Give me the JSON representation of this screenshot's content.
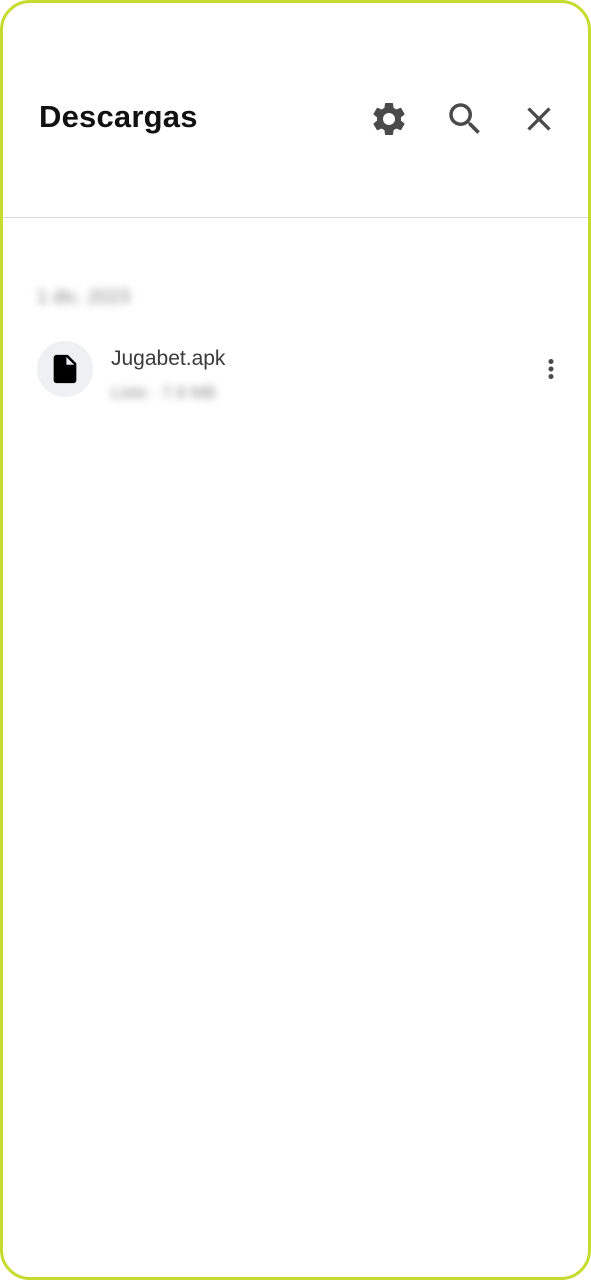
{
  "header": {
    "title": "Descargas",
    "icons": {
      "settings": "gear-icon",
      "search": "search-icon",
      "close": "close-icon"
    }
  },
  "downloads": {
    "groups": [
      {
        "date_label": "1 dic. 2023",
        "items": [
          {
            "name": "Jugabet.apk",
            "meta": "Listo · 7.9 MB",
            "icon": "file-icon"
          }
        ]
      }
    ]
  },
  "colors": {
    "frame": "#c5dc2c",
    "icon": "#4a4a4a",
    "divider": "#dadada"
  }
}
